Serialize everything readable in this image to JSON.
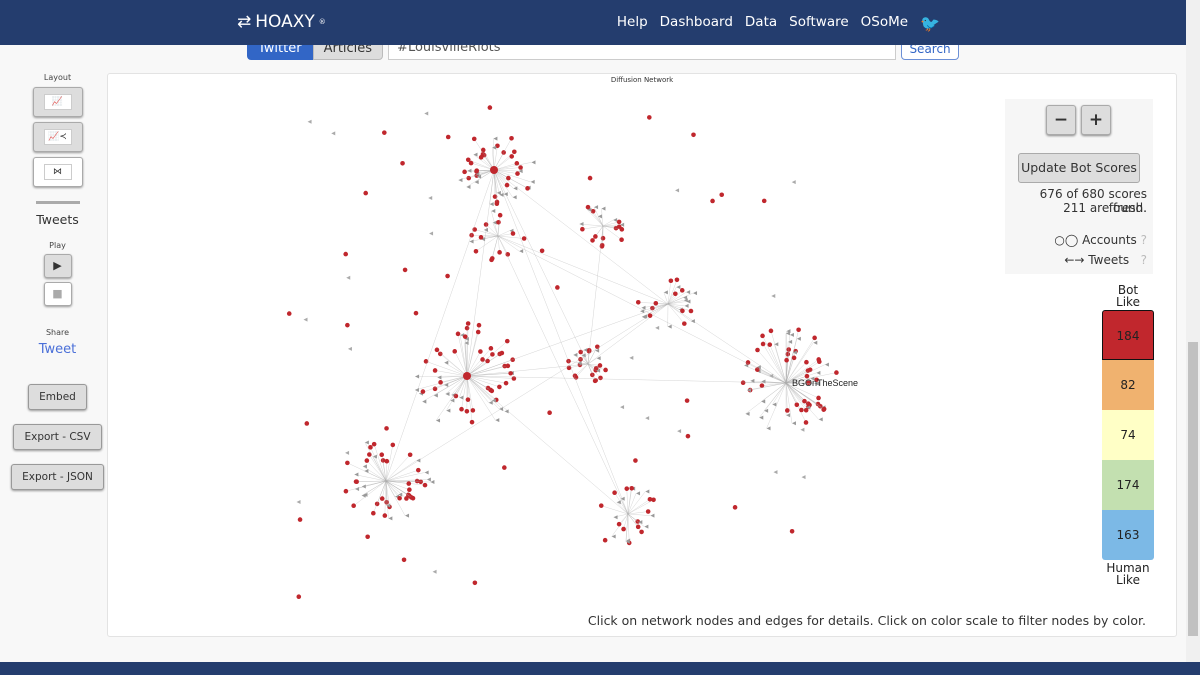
{
  "header": {
    "logo": "HOAXY",
    "logo_mark": "®",
    "nav": [
      "Help",
      "Dashboard",
      "Data",
      "Software",
      "OSoMe"
    ],
    "twitter_icon": "twitter-bird-icon"
  },
  "search": {
    "tabs": [
      "Twitter",
      "Articles"
    ],
    "active_tab": "Twitter",
    "query": "#LouisvilleRiots",
    "button": "Search"
  },
  "sidebar": {
    "layout_label": "Layout",
    "section": "Tweets",
    "play_label": "Play",
    "share_label": "Share",
    "share_link": "Tweet",
    "embed": "Embed",
    "export_csv": "Export - CSV",
    "export_json": "Export - JSON"
  },
  "network": {
    "title": "Diffusion Network",
    "hub_label": "BGOnTheScene",
    "node_color": "#c0272d",
    "edge_color": "#aaaaaa"
  },
  "controls": {
    "zoom_out": "−",
    "zoom_in": "+",
    "update": "Update Bot Scores",
    "status1": "676 of 680 scores found.",
    "status2": "211 are fresh.",
    "legend_accounts": "Accounts",
    "legend_tweets": "Tweets"
  },
  "scale": {
    "top": "Bot Like",
    "bottom": "Human Like",
    "bins": [
      {
        "count": "184",
        "color": "#c1272d"
      },
      {
        "count": "82",
        "color": "#f0b26f"
      },
      {
        "count": "74",
        "color": "#ffffc6"
      },
      {
        "count": "174",
        "color": "#c3e0b0"
      },
      {
        "count": "163",
        "color": "#7cb9e6"
      }
    ]
  },
  "hint": "Click on network nodes and edges for details. Click on color scale to filter nodes by color."
}
